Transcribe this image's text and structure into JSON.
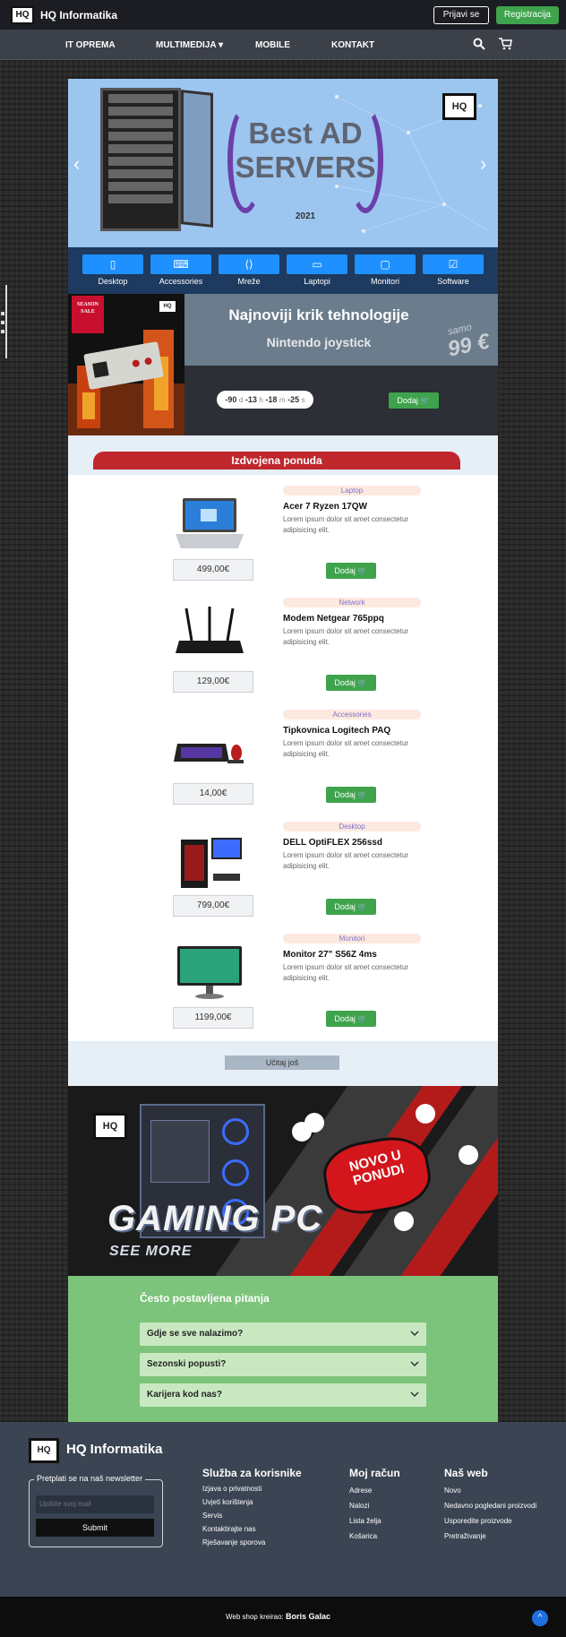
{
  "header": {
    "logo_text": "HQ",
    "brand": "HQ Informatika",
    "login_label": "Prijavi se",
    "register_label": "Registracija"
  },
  "nav": {
    "items": [
      "IT OPREMA",
      "MULTIMEDIJA",
      "MOBILE",
      "KONTAKT"
    ],
    "dropdown_marker": "▾",
    "search_icon": "search-icon",
    "cart_icon": "cart-icon"
  },
  "hero": {
    "title_line1": "Best AD",
    "title_line2": "SERVERS",
    "year": "2021",
    "prev": "‹",
    "next": "›"
  },
  "categories": [
    {
      "label": "Desktop",
      "icon": "▯"
    },
    {
      "label": "Accessories",
      "icon": "⌨"
    },
    {
      "label": "Mreže",
      "icon": "⟨⟩"
    },
    {
      "label": "Laptopi",
      "icon": "▭"
    },
    {
      "label": "Monitori",
      "icon": "▢"
    },
    {
      "label": "Software",
      "icon": "☑"
    }
  ],
  "promo": {
    "heading": "Najnoviji krik tehnologije",
    "subheading": "Nintendo joystick",
    "sale_tag": "SEASON SALE",
    "price_prefix": "samo",
    "price": "99 €",
    "timer": {
      "d": "-90",
      "h": "-13",
      "m": "-18",
      "s": "-25"
    },
    "timer_units": {
      "d": "d",
      "h": "h",
      "m": "m",
      "s": "s"
    },
    "add_label": "Dodaj 🛒"
  },
  "featured": {
    "title": "Izdvojena ponuda",
    "add_label": "Dodaj 🛒",
    "load_more": "Učitaj još",
    "products": [
      {
        "tag": "Laptop",
        "name": "Acer 7 Ryzen 17QW",
        "desc": "Lorem ipsum dolor sit amet consectetur adipisicing elit.",
        "price": "499,00€"
      },
      {
        "tag": "Network",
        "name": "Modem Netgear 765ppq",
        "desc": "Lorem ipsum dolor sit amet consectetur adipisicing elit.",
        "price": "129,00€"
      },
      {
        "tag": "Accessories",
        "name": "Tipkovnica Logitech PAQ",
        "desc": "Lorem ipsum dolor sit amet consectetur adipisicing elit.",
        "price": "14,00€"
      },
      {
        "tag": "Desktop",
        "name": "DELL OptiFLEX 256ssd",
        "desc": "Lorem ipsum dolor sit amet consectetur adipisicing elit.",
        "price": "799,00€"
      },
      {
        "tag": "Monitori",
        "name": "Monitor 27\" S56Z 4ms",
        "desc": "Lorem ipsum dolor sit amet consectetur adipisicing elit.",
        "price": "1199,00€"
      }
    ]
  },
  "gaming": {
    "logo_text": "HQ",
    "badge": "NOVO U PONUDI",
    "title": "GAMING PC",
    "subtitle": "SEE MORE"
  },
  "faq": {
    "title": "Često postavljena pitanja",
    "questions": [
      "Gdje se sve nalazimo?",
      "Sezonski popusti?",
      "Karijera kod nas?"
    ]
  },
  "footer": {
    "logo_text": "HQ",
    "brand": "HQ Informatika",
    "newsletter_legend": "Pretplati se na naš newsletter",
    "newsletter_placeholder": "Upišite svoj mail",
    "submit_label": "Submit",
    "col1_title": "Služba za korisnike",
    "col1_links": [
      "Izjava o privatnosti",
      "Uvjeti korištenja",
      "Servis",
      "Kontaktirajte nas",
      "Rješavanje sporova"
    ],
    "col2_title": "Moj račun",
    "col2_links": [
      "Adrese",
      "Nalozi",
      "Lista želja",
      "Košarica"
    ],
    "col3_title": "Naš web",
    "col3_links": [
      "Novo",
      "Nedavno pogledani proizvodi",
      "Usporedite proizvode",
      "Pretraživanje"
    ],
    "credit_prefix": "Web shop kreirao:",
    "credit_name": "Boris Galac",
    "to_top": "^"
  },
  "colors": {
    "accent_green": "#3fa34d",
    "accent_red": "#c0272d",
    "category_blue": "#1e90ff",
    "footer_bg": "#3a4452"
  }
}
